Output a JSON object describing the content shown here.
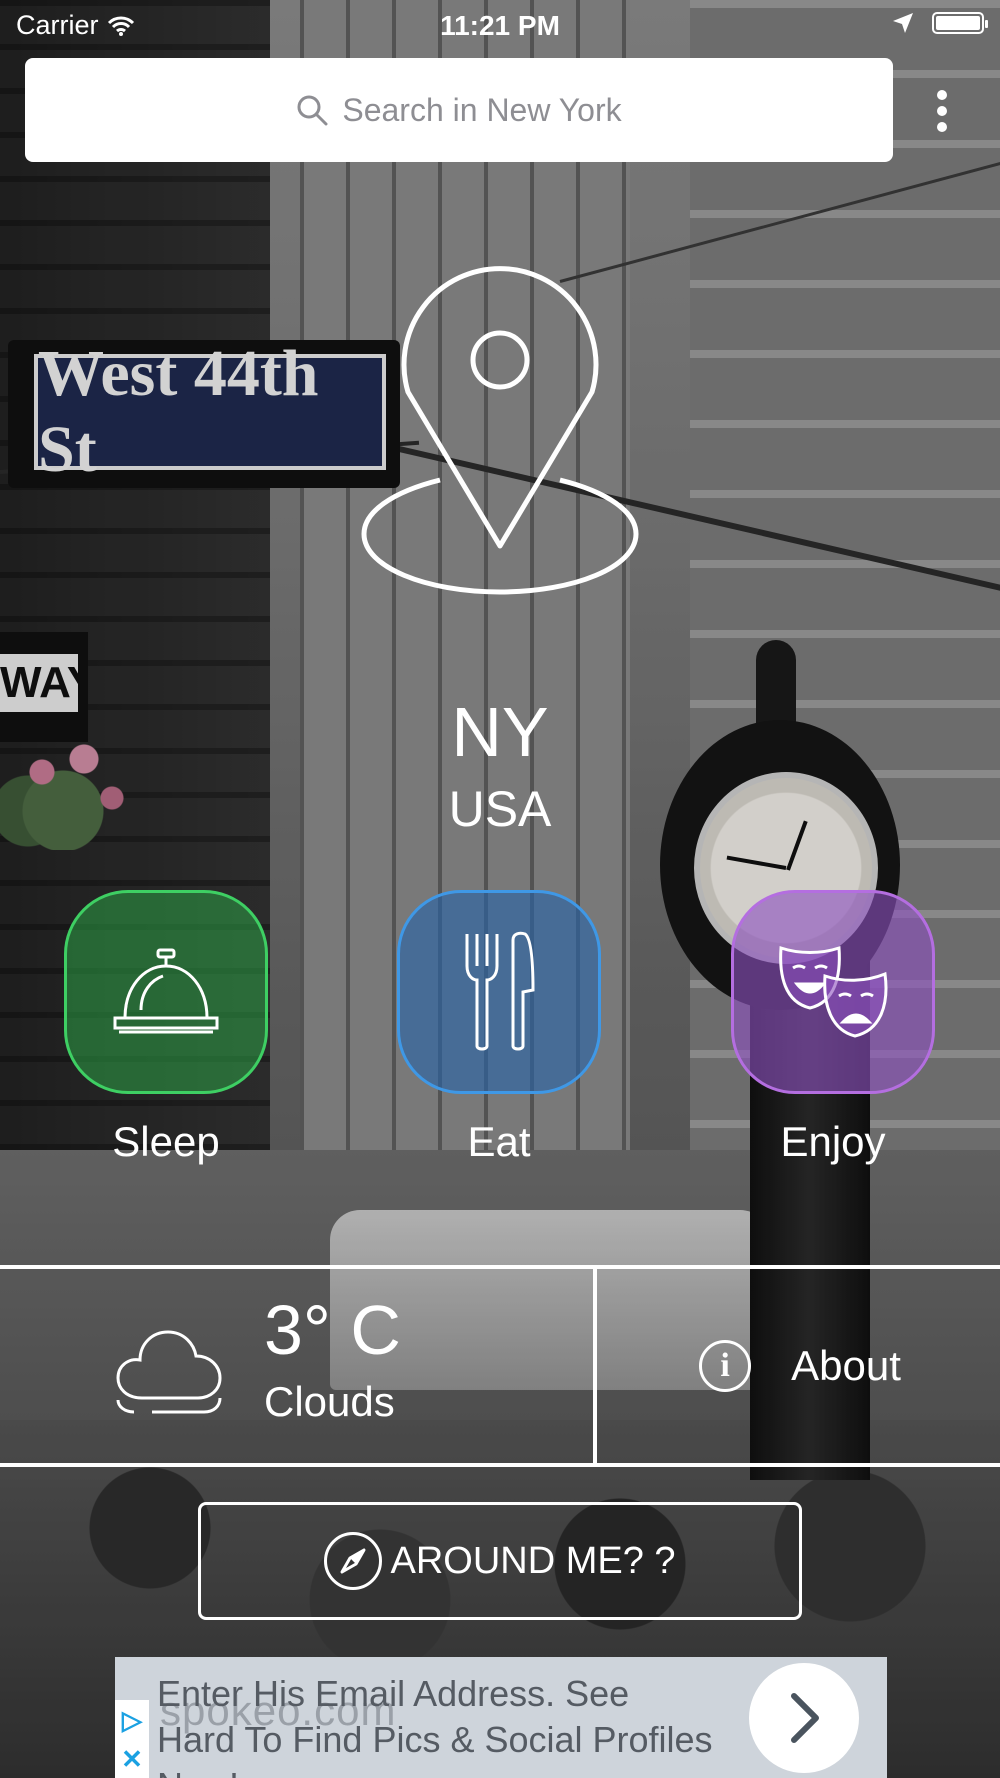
{
  "status_bar": {
    "carrier": "Carrier",
    "time": "11:21 PM"
  },
  "search": {
    "placeholder": "Search in New York"
  },
  "background": {
    "street_sign": "West 44th St",
    "way_sign": "WAY"
  },
  "hero": {
    "city": "NY",
    "country": "USA"
  },
  "categories": [
    {
      "label": "Sleep",
      "color": "#3ecf63",
      "icon": "service-bell-icon"
    },
    {
      "label": "Eat",
      "color": "#3f98e6",
      "icon": "fork-knife-icon"
    },
    {
      "label": "Enjoy",
      "color": "#b46ee0",
      "icon": "theater-masks-icon"
    }
  ],
  "weather": {
    "temperature": "3° C",
    "condition": "Clouds",
    "icon": "cloud-icon"
  },
  "about": {
    "label": "About"
  },
  "around_me": {
    "label": "AROUND ME? ?"
  },
  "ad": {
    "text": "Enter His Email Address. See Hard To Find Pics & Social Profiles Now!",
    "watermark": "spokeo.com"
  }
}
